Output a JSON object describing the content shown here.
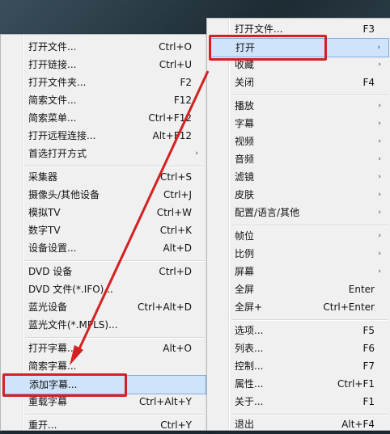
{
  "left_menu": {
    "items": [
      {
        "label": "打开文件...",
        "shortcut": "Ctrl+O"
      },
      {
        "label": "打开链接...",
        "shortcut": "Ctrl+U"
      },
      {
        "label": "打开文件夹...",
        "shortcut": "F2"
      },
      {
        "label": "简索文件...",
        "shortcut": "F12"
      },
      {
        "label": "简索菜单...",
        "shortcut": "Ctrl+F12"
      },
      {
        "label": "打开远程连接...",
        "shortcut": "Alt+F12"
      },
      {
        "label": "首选打开方式",
        "shortcut": "",
        "submenu": true
      },
      {
        "label": "采集器",
        "shortcut": "Ctrl+S"
      },
      {
        "label": "摄像头/其他设备",
        "shortcut": "Ctrl+J"
      },
      {
        "label": "模拟TV",
        "shortcut": "Ctrl+W"
      },
      {
        "label": "数字TV",
        "shortcut": "Ctrl+K"
      },
      {
        "label": "设备设置...",
        "shortcut": "Alt+D"
      },
      {
        "label": "DVD 设备",
        "shortcut": "Ctrl+D"
      },
      {
        "label": "DVD 文件(*.IFO)...",
        "shortcut": ""
      },
      {
        "label": "蓝光设备",
        "shortcut": "Ctrl+Alt+D"
      },
      {
        "label": "蓝光文件(*.MPLS)...",
        "shortcut": ""
      },
      {
        "label": "打开字幕...",
        "shortcut": "Alt+O"
      },
      {
        "label": "简索字幕...",
        "shortcut": ""
      },
      {
        "label": "添加字幕...",
        "shortcut": ""
      },
      {
        "label": "重载字幕",
        "shortcut": "Ctrl+Alt+Y"
      },
      {
        "label": "重开...",
        "shortcut": "Ctrl+Y"
      }
    ]
  },
  "right_menu": {
    "items": [
      {
        "label": "打开文件...",
        "shortcut": "F3"
      },
      {
        "label": "打开",
        "shortcut": "",
        "submenu": true
      },
      {
        "label": "收藏",
        "shortcut": "",
        "submenu": true
      },
      {
        "label": "关闭",
        "shortcut": "F4"
      },
      {
        "label": "播放",
        "shortcut": "",
        "submenu": true
      },
      {
        "label": "字幕",
        "shortcut": "",
        "submenu": true
      },
      {
        "label": "视频",
        "shortcut": "",
        "submenu": true
      },
      {
        "label": "音频",
        "shortcut": "",
        "submenu": true
      },
      {
        "label": "滤镜",
        "shortcut": "",
        "submenu": true
      },
      {
        "label": "皮肤",
        "shortcut": "",
        "submenu": true
      },
      {
        "label": "配置/语言/其他",
        "shortcut": "",
        "submenu": true
      },
      {
        "label": "帧位",
        "shortcut": "",
        "submenu": true
      },
      {
        "label": "比例",
        "shortcut": "",
        "submenu": true
      },
      {
        "label": "屏幕",
        "shortcut": "",
        "submenu": true
      },
      {
        "label": "全屏",
        "shortcut": "Enter"
      },
      {
        "label": "全屏+",
        "shortcut": "Ctrl+Enter"
      },
      {
        "label": "选项...",
        "shortcut": "F5"
      },
      {
        "label": "列表...",
        "shortcut": "F6"
      },
      {
        "label": "控制...",
        "shortcut": "F7"
      },
      {
        "label": "属性...",
        "shortcut": "Ctrl+F1"
      },
      {
        "label": "关于...",
        "shortcut": "F1"
      },
      {
        "label": "退出",
        "shortcut": "Alt+F4"
      }
    ]
  },
  "arrow_glyph": "›",
  "colors": {
    "annotation_red": "#d42020",
    "highlight_bg": "#cfe3fa",
    "menu_bg": "#f0f0f0"
  }
}
